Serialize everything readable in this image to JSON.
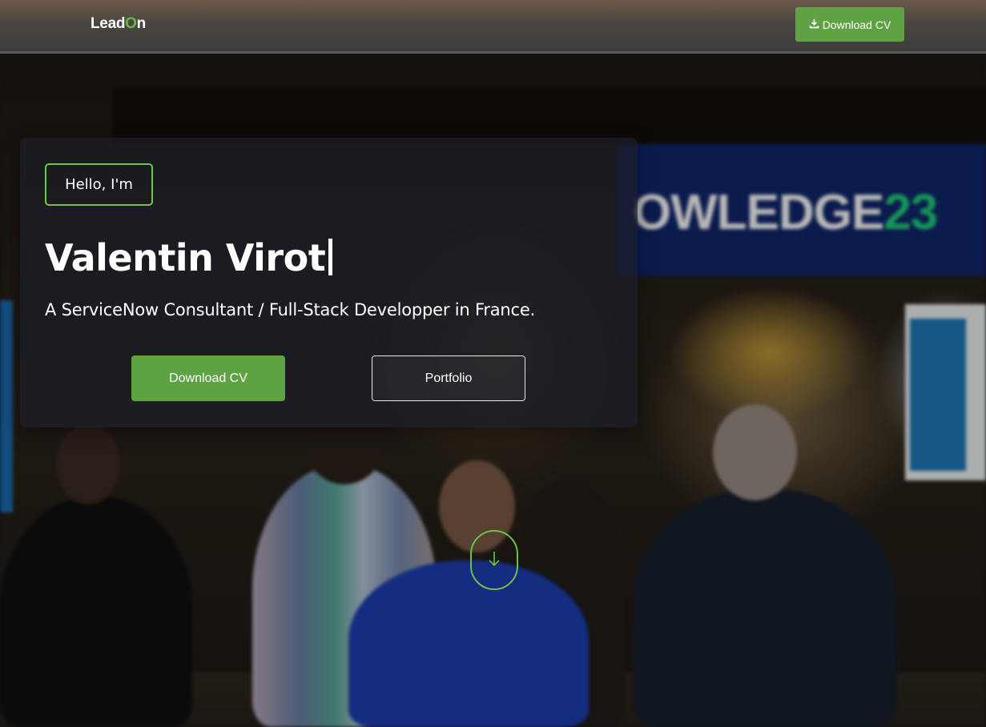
{
  "navbar": {
    "logo_prefix": "Lead",
    "logo_highlight": "O",
    "logo_suffix": "n",
    "download_cv_label": "Download CV"
  },
  "background": {
    "banner_text": "OWLEDGE",
    "banner_number": "23"
  },
  "hero": {
    "greeting": "Hello, I'm",
    "name": "Valentin Virot",
    "tagline": "A ServiceNow Consultant / Full-Stack Developper in France.",
    "primary_button": "Download CV",
    "secondary_button": "Portfolio"
  },
  "icons": {
    "download": "download-icon",
    "scroll": "arrow-down-icon"
  },
  "colors": {
    "accent_green": "#5ea243",
    "outline_green": "#71c447",
    "banner_blue": "#10266b",
    "banner_number_green": "#1fd07b"
  }
}
